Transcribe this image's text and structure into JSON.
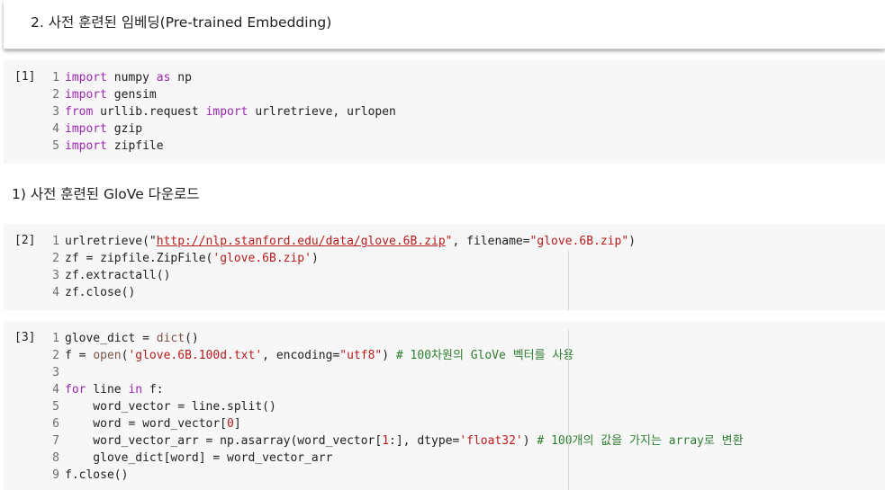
{
  "section_heading": "2. 사전 훈련된 임베딩(Pre-trained Embedding)",
  "subheading": "1) 사전 훈련된 GloVe 다운로드",
  "cells": [
    {
      "count": "[1]",
      "lines": [
        {
          "n": "1",
          "tokens": [
            {
              "t": "import",
              "c": "kw"
            },
            {
              "t": " numpy "
            },
            {
              "t": "as",
              "c": "kw"
            },
            {
              "t": " np"
            }
          ]
        },
        {
          "n": "2",
          "tokens": [
            {
              "t": "import",
              "c": "kw"
            },
            {
              "t": " gensim"
            }
          ]
        },
        {
          "n": "3",
          "tokens": [
            {
              "t": "from",
              "c": "kw"
            },
            {
              "t": " urllib.request "
            },
            {
              "t": "import",
              "c": "kw"
            },
            {
              "t": " urlretrieve, urlopen"
            }
          ]
        },
        {
          "n": "4",
          "tokens": [
            {
              "t": "import",
              "c": "kw"
            },
            {
              "t": " gzip"
            }
          ]
        },
        {
          "n": "5",
          "tokens": [
            {
              "t": "import",
              "c": "kw"
            },
            {
              "t": " zipfile"
            }
          ]
        }
      ]
    },
    {
      "count": "[2]",
      "lines": [
        {
          "n": "1",
          "tokens": [
            {
              "t": "urlretrieve(\""
            },
            {
              "t": "http://nlp.stanford.edu/data/glove.6B.zip",
              "c": "url"
            },
            {
              "t": "\"",
              "c": "str"
            },
            {
              "t": ", filename="
            },
            {
              "t": "\"glove.6B.zip\"",
              "c": "str"
            },
            {
              "t": ")"
            }
          ]
        },
        {
          "n": "2",
          "tokens": [
            {
              "t": "zf = zipfile.ZipFile("
            },
            {
              "t": "'glove.6B.zip'",
              "c": "str"
            },
            {
              "t": ")"
            }
          ]
        },
        {
          "n": "3",
          "tokens": [
            {
              "t": "zf.extractall()"
            }
          ]
        },
        {
          "n": "4",
          "tokens": [
            {
              "t": "zf.close()"
            }
          ]
        }
      ]
    },
    {
      "count": "[3]",
      "lines": [
        {
          "n": "1",
          "tokens": [
            {
              "t": "glove_dict = "
            },
            {
              "t": "dict",
              "c": "bi"
            },
            {
              "t": "()"
            }
          ]
        },
        {
          "n": "2",
          "tokens": [
            {
              "t": "f = "
            },
            {
              "t": "open",
              "c": "bi"
            },
            {
              "t": "("
            },
            {
              "t": "'glove.6B.100d.txt'",
              "c": "str"
            },
            {
              "t": ", encoding="
            },
            {
              "t": "\"utf8\"",
              "c": "str"
            },
            {
              "t": ") "
            },
            {
              "t": "# 100차원의 GloVe 벡터를 사용",
              "c": "cm"
            }
          ]
        },
        {
          "n": "3",
          "tokens": []
        },
        {
          "n": "4",
          "tokens": [
            {
              "t": "for",
              "c": "kw"
            },
            {
              "t": " line "
            },
            {
              "t": "in",
              "c": "kw"
            },
            {
              "t": " f:"
            }
          ]
        },
        {
          "n": "5",
          "tokens": [
            {
              "t": "    word_vector = line.split()"
            }
          ]
        },
        {
          "n": "6",
          "tokens": [
            {
              "t": "    word = word_vector["
            },
            {
              "t": "0",
              "c": "num"
            },
            {
              "t": "]"
            }
          ]
        },
        {
          "n": "7",
          "tokens": [
            {
              "t": "    word_vector_arr = np.asarray(word_vector["
            },
            {
              "t": "1",
              "c": "num"
            },
            {
              "t": ":], dtype="
            },
            {
              "t": "'float32'",
              "c": "str"
            },
            {
              "t": ") "
            },
            {
              "t": "# 100개의 값을 가지는 array로 변환",
              "c": "cm"
            }
          ]
        },
        {
          "n": "8",
          "tokens": [
            {
              "t": "    glove_dict[word] = word_vector_arr"
            }
          ]
        },
        {
          "n": "9",
          "tokens": [
            {
              "t": "f.close()"
            }
          ]
        }
      ]
    }
  ]
}
